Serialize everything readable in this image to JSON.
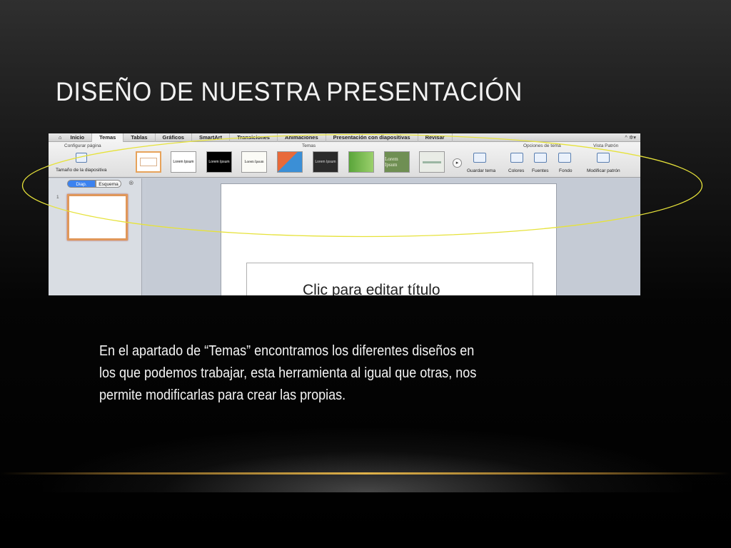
{
  "slide": {
    "title": "DISEÑO DE NUESTRA PRESENTACIÓN",
    "body": "En el apartado de “Temas” encontramos los diferentes diseños en los que podemos trabajar, esta herramienta al igual que otras, nos permite modificarlas para crear las propias."
  },
  "screenshot": {
    "menu_tabs": [
      "Inicio",
      "Temas",
      "Tablas",
      "Gráficos",
      "SmartArt",
      "Transiciones",
      "Animaciones",
      "Presentación con diapositivas",
      "Revisar"
    ],
    "ribbon": {
      "group_page_setup": "Configurar página",
      "page_size_label": "Tamaño de la diapositiva",
      "group_themes": "Temas",
      "theme_thumb_text": "Lorem Ipsum",
      "save_theme": "Guardar tema",
      "group_theme_options": "Opciones de tema",
      "colors": "Colores",
      "fonts": "Fuentes",
      "background": "Fondo",
      "group_master_view": "Vista Patrón",
      "edit_master": "Modificar patrón"
    },
    "pane": {
      "slides_tab": "Diap.",
      "outline_tab": "Esquema",
      "slide_number": "1"
    },
    "title_placeholder": "Clic para editar título"
  },
  "colors": {
    "highlight_ellipse": "#e6e23a",
    "accent_line": "#e0b24a"
  }
}
